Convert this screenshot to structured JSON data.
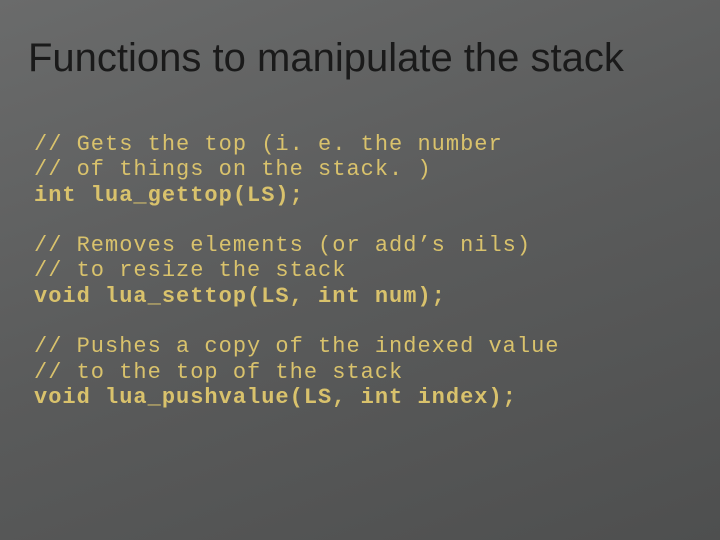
{
  "title": "Functions to manipulate the stack",
  "block1": {
    "c1": "// Gets the top (i. e. the number",
    "c2": "// of things on the stack. )",
    "sig": "int lua_gettop(LS);"
  },
  "block2": {
    "c1": "// Removes elements (or add’s nils)",
    "c2": "// to resize the stack",
    "sig": "void lua_settop(LS, int num);"
  },
  "block3": {
    "c1": "// Pushes a copy of the indexed value",
    "c2": "// to the top of the stack",
    "sig": "void lua_pushvalue(LS, int index);"
  }
}
